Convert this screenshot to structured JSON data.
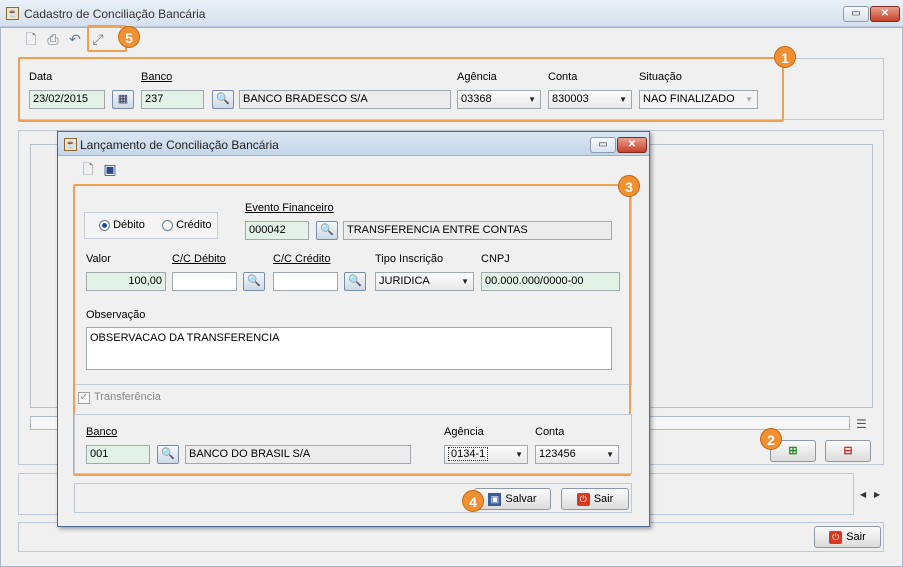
{
  "window": {
    "title": "Cadastro de Conciliação Bancária",
    "min_label": "▭",
    "close_label": "✕"
  },
  "toolbar": {
    "new_icon": "new-document-icon",
    "print_icon": "print-icon",
    "undo_icon": "undo-icon",
    "tool_icon": "wand-icon"
  },
  "badges": {
    "b1": "1",
    "b2": "2",
    "b3": "3",
    "b4": "4",
    "b5": "5"
  },
  "header": {
    "data_label": "Data",
    "data_value": "23/02/2015",
    "banco_label": "Banco",
    "banco_code": "237",
    "banco_name": "BANCO BRADESCO S/A",
    "agencia_label": "Agência",
    "agencia_value": "03368",
    "conta_label": "Conta",
    "conta_value": "830003",
    "situacao_label": "Situação",
    "situacao_value": "NAO FINALIZADO"
  },
  "main_footer": {
    "sair_label": "Sair"
  },
  "dialog": {
    "title": "Lançamento de Conciliação Bancária",
    "debito_label": "Débito",
    "credito_label": "Crédito",
    "evento_label": "Evento Financeiro",
    "evento_code": "000042",
    "evento_name": "TRANSFERENCIA ENTRE CONTAS",
    "valor_label": "Valor",
    "valor_value": "100,00",
    "cc_debito_label": "C/C Débito",
    "cc_debito_value": "",
    "cc_credito_label": "C/C Crédito",
    "cc_credito_value": "",
    "tipo_label": "Tipo Inscrição",
    "tipo_value": "JURIDICA",
    "cnpj_label": "CNPJ",
    "cnpj_value": "00.000.000/0000-00",
    "obs_label": "Observação",
    "obs_value": "OBSERVACAO DA TRANSFERENCIA",
    "transferencia_label": "Transferência",
    "banco_label": "Banco",
    "banco_code": "001",
    "banco_name": "BANCO DO BRASIL S/A",
    "agencia_label": "Agência",
    "agencia_value": "0134-1",
    "conta_label": "Conta",
    "conta_value": "123456",
    "salvar_label": "Salvar",
    "sair_label": "Sair"
  },
  "colors": {
    "highlight": "#f0a050",
    "badge": "#f09030",
    "green_field": "#e2f2e6"
  }
}
